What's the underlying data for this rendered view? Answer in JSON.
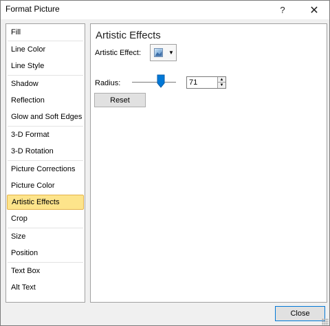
{
  "window": {
    "title": "Format Picture",
    "help_label": "?",
    "close_label": "✕"
  },
  "nav": {
    "items": [
      {
        "label": "Fill"
      },
      {
        "label": "Line Color"
      },
      {
        "label": "Line Style"
      },
      {
        "label": "Shadow"
      },
      {
        "label": "Reflection"
      },
      {
        "label": "Glow and Soft Edges"
      },
      {
        "label": "3-D Format"
      },
      {
        "label": "3-D Rotation"
      },
      {
        "label": "Picture Corrections"
      },
      {
        "label": "Picture Color"
      },
      {
        "label": "Artistic Effects"
      },
      {
        "label": "Crop"
      },
      {
        "label": "Size"
      },
      {
        "label": "Position"
      },
      {
        "label": "Text Box"
      },
      {
        "label": "Alt Text"
      }
    ],
    "selected": "Artistic Effects"
  },
  "panel": {
    "title": "Artistic Effects",
    "artistic_effect_label": "Artistic Effect:",
    "radius_label": "Radius:",
    "radius_value": "71",
    "reset_label": "Reset"
  },
  "footer": {
    "close_label": "Close"
  },
  "colors": {
    "selected_bg": "#fde48b",
    "selected_border": "#e3b24a",
    "slider_thumb": "#0078d7",
    "default_button_border": "#0078d7"
  }
}
